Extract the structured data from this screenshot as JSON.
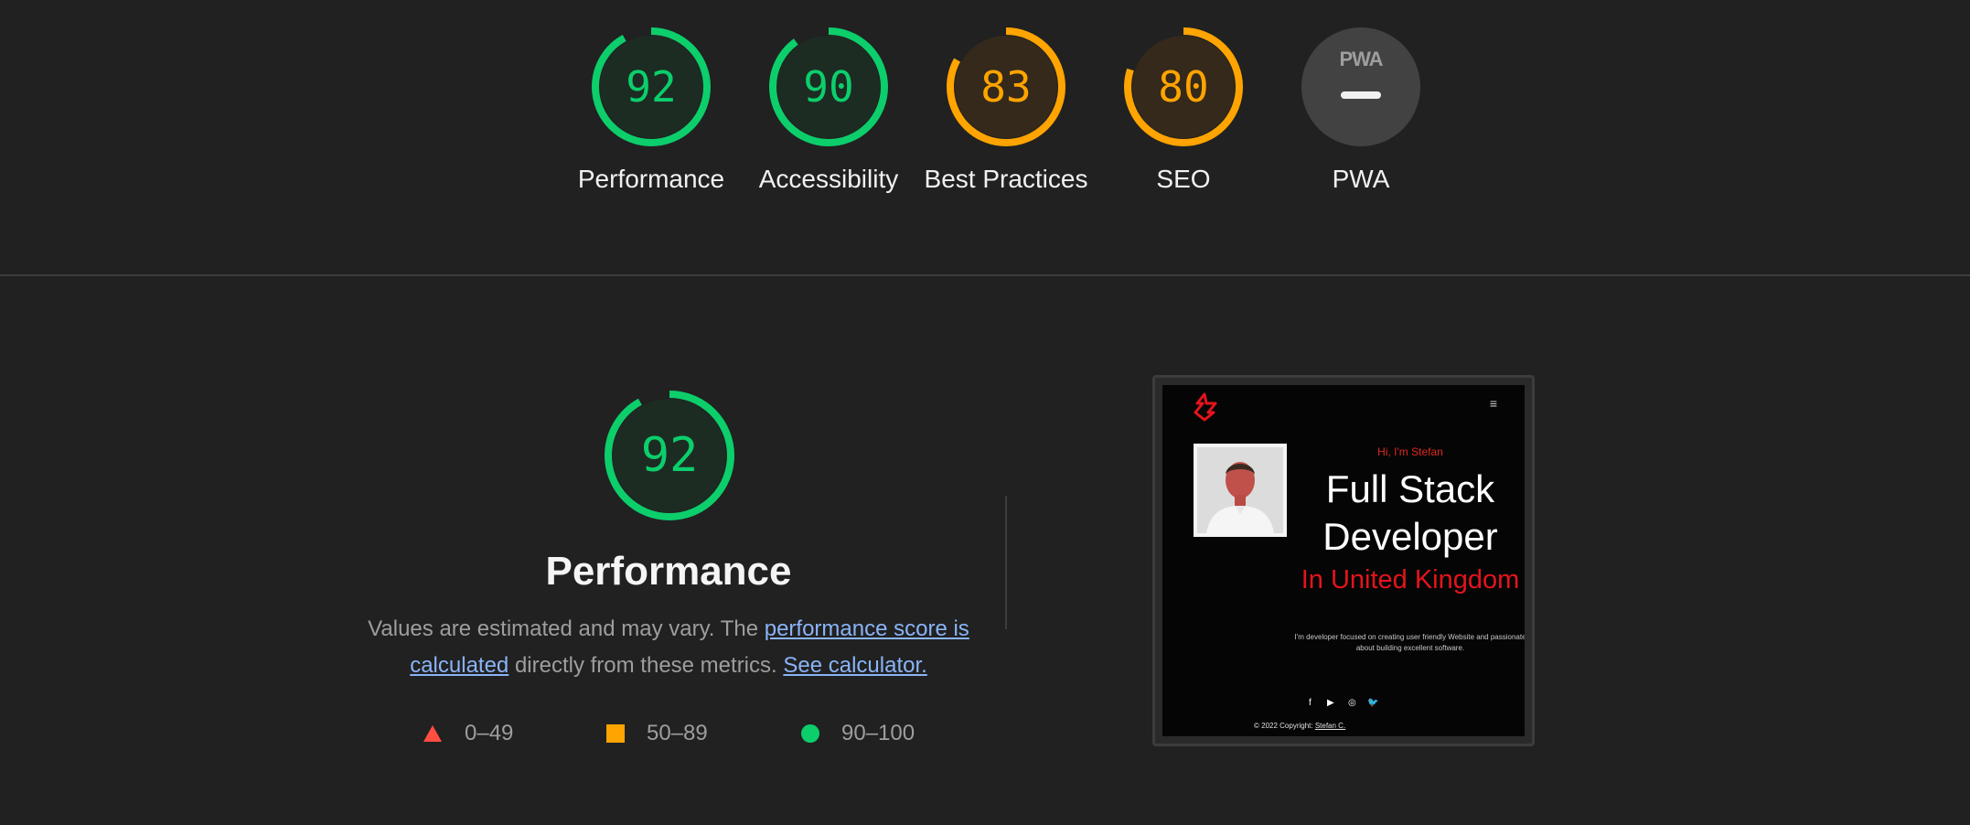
{
  "colors": {
    "pass": "#0cce6b",
    "average": "#ffa400",
    "fail": "#ff4e42",
    "pwa_gray": "#9e9e9e"
  },
  "categories": [
    {
      "id": "performance",
      "score": "92",
      "label": "Performance",
      "status": "pass",
      "score_fraction": 0.92
    },
    {
      "id": "accessibility",
      "score": "90",
      "label": "Accessibility",
      "status": "pass",
      "score_fraction": 0.9
    },
    {
      "id": "best-practices",
      "score": "83",
      "label": "Best Practices",
      "status": "average",
      "score_fraction": 0.83
    },
    {
      "id": "seo",
      "score": "80",
      "label": "SEO",
      "status": "average",
      "score_fraction": 0.8
    },
    {
      "id": "pwa",
      "score": "",
      "label": "PWA",
      "status": "pwa",
      "badge_text": "PWA",
      "badge_dash": "—"
    }
  ],
  "performance_section": {
    "score": "92",
    "score_fraction": 0.92,
    "title": "Performance",
    "desc_prefix": "Values are estimated and may vary. The ",
    "link1": "performance score is calculated",
    "desc_middle": " directly from these metrics. ",
    "link2": "See calculator.",
    "legend": [
      {
        "shape": "triangle",
        "range": "0–49",
        "color": "#ff4e42"
      },
      {
        "shape": "square",
        "range": "50–89",
        "color": "#ffa400"
      },
      {
        "shape": "circle",
        "range": "90–100",
        "color": "#0cce6b"
      }
    ]
  },
  "screenshot": {
    "menu_icon": "≡",
    "greeting": "Hi, I'm Stefan",
    "headline": "Full Stack Developer",
    "location": "In United Kingdom",
    "tagline": "I'm developer focused on creating user friendly Website and passionate about building excellent software.",
    "socials": [
      "f",
      "▶",
      "◎",
      "🐦"
    ],
    "footer_prefix": "© 2022 Copyright: ",
    "footer_link": "Stefan C."
  }
}
